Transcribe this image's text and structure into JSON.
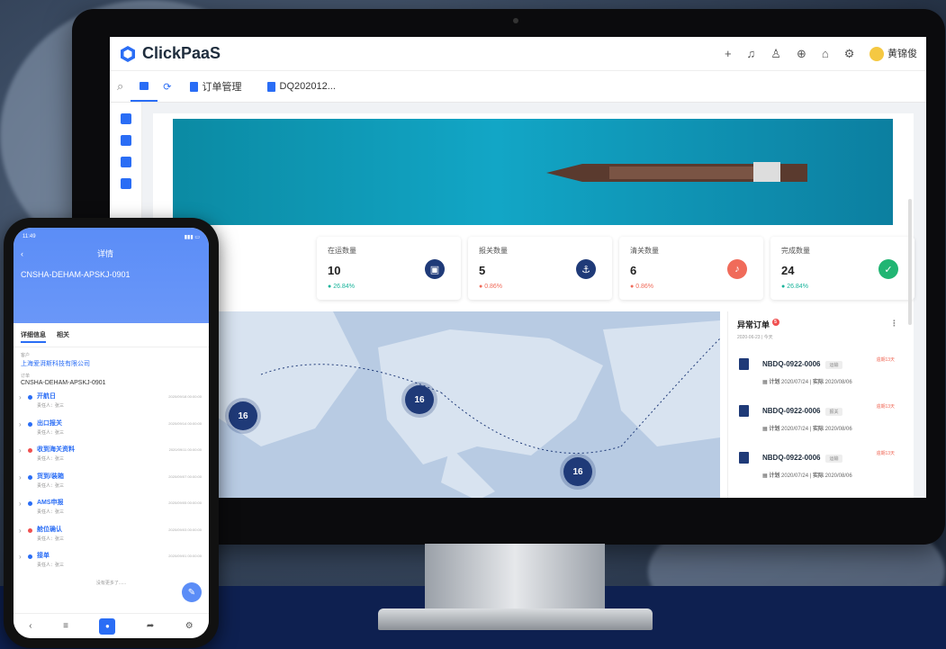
{
  "desktop": {
    "logo": "ClickPaaS",
    "user": "黄锦俊",
    "tabs": [
      "订单管理",
      "DQ202012..."
    ],
    "stats": [
      {
        "title": "在运数量",
        "value": "10",
        "pct": "26.84%",
        "trend": "up",
        "color": "#1f3a78",
        "icon": "box-icon"
      },
      {
        "title": "报关数量",
        "value": "5",
        "pct": "0.86%",
        "trend": "down",
        "color": "#1f3a78",
        "icon": "anchor-icon"
      },
      {
        "title": "清关数量",
        "value": "6",
        "pct": "0.86%",
        "trend": "down",
        "color": "#f06b5a",
        "icon": "bell-icon"
      },
      {
        "title": "完成数量",
        "value": "24",
        "pct": "26.84%",
        "trend": "up",
        "color": "#21b573",
        "icon": "check-icon"
      }
    ],
    "map_clusters": [
      "16",
      "16",
      "16"
    ],
    "abnormal": {
      "title": "异常订单",
      "badge": "5",
      "subtitle": "2020-06-23 | 今天",
      "orders": [
        {
          "no": "NBDQ-0922-0006",
          "tag": "运输",
          "late": "逾期13天",
          "plan_label": "计划",
          "plan": "2020/07/24",
          "actual_label": "实际",
          "actual": "2020/08/06"
        },
        {
          "no": "NBDQ-0922-0006",
          "tag": "报关",
          "late": "逾期13天",
          "plan_label": "计划",
          "plan": "2020/07/24",
          "actual_label": "实际",
          "actual": "2020/08/06"
        },
        {
          "no": "NBDQ-0922-0006",
          "tag": "运输",
          "late": "逾期13天",
          "plan_label": "计划",
          "plan": "2020/07/24",
          "actual_label": "实际",
          "actual": "2020/08/06"
        }
      ]
    }
  },
  "phone": {
    "time": "11:49",
    "header_title": "详情",
    "code": "CNSHA-DEHAM-APSKJ-0901",
    "tabs": [
      "详细信息",
      "相关"
    ],
    "customer_label": "客户",
    "customer": "上海爱湃斯科技有限公司",
    "order_label": "订单",
    "order": "CNSHA-DEHAM-APSKJ-0901",
    "timeline": [
      {
        "title": "开航日",
        "person": "责任人：张三",
        "date": "2020/09/18 00:00:00",
        "color": "#2a6df5"
      },
      {
        "title": "出口报关",
        "person": "责任人：张三",
        "date": "2020/09/14 00:00:00",
        "color": "#2a6df5"
      },
      {
        "title": "收到海关资料",
        "person": "责任人：张三",
        "date": "2020/09/11 00:00:00",
        "color": "#f05050"
      },
      {
        "title": "货到/装箱",
        "person": "责任人：张三",
        "date": "2020/09/07 00:00:00",
        "color": "#2a6df5"
      },
      {
        "title": "AMS申报",
        "person": "责任人：张三",
        "date": "2020/09/05 00:00:00",
        "color": "#2a6df5"
      },
      {
        "title": "舱位确认",
        "person": "责任人：张三",
        "date": "2020/09/03 00:00:00",
        "color": "#f05050"
      },
      {
        "title": "接单",
        "person": "责任人：张三",
        "date": "2020/09/01 00:00:00",
        "color": "#2a6df5"
      }
    ],
    "more": "没有更多了......"
  }
}
